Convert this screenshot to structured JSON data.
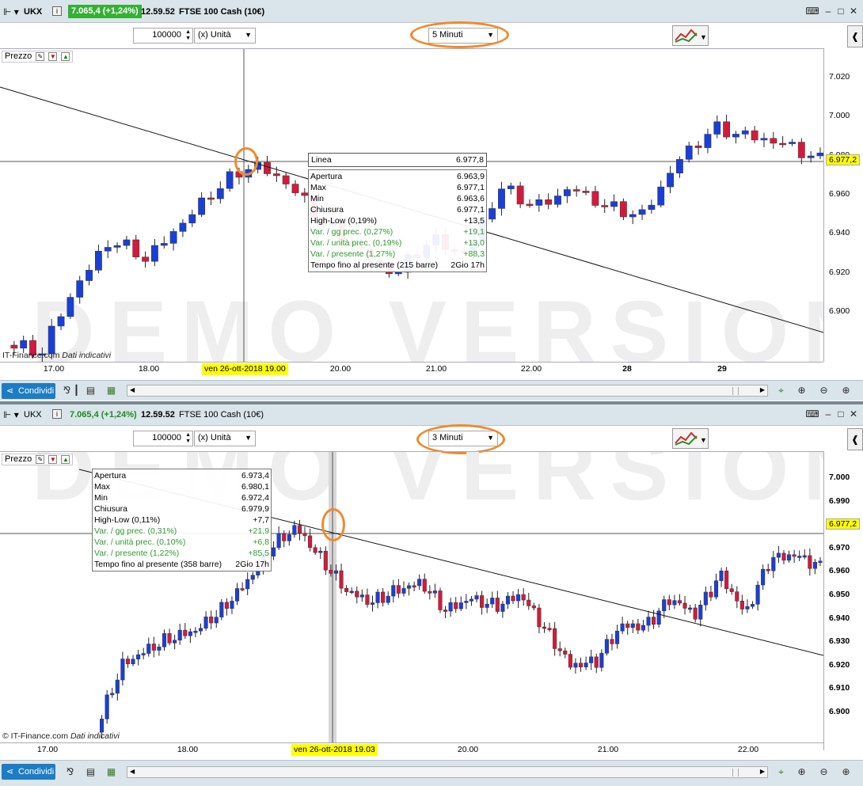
{
  "colors": {
    "up_candle": "#1a3fd8",
    "down_candle": "#d41a3c",
    "price_badge_bg": "#35b035",
    "highlight_yellow": "#ffff00",
    "annotation_orange": "#f08a2c",
    "share_button": "#1d7cc4"
  },
  "top": {
    "title": {
      "symbol": "UKX",
      "price_change": "7.065,4 (+1,24%)",
      "time": "12.59.52",
      "instrument": "FTSE 100 Cash (10€)"
    },
    "toolbar": {
      "quantity": "100000",
      "unit": "(x) Unità",
      "timeframe": "5 Minuti"
    },
    "prezzo_label": "Prezzo",
    "line_label": {
      "name": "Linea",
      "value": "6.977,8"
    },
    "tooltip": [
      {
        "label": "Apertura",
        "value": "6.963,9",
        "green": false
      },
      {
        "label": "Max",
        "value": "6.977,1",
        "green": false
      },
      {
        "label": "Min",
        "value": "6.963,6",
        "green": false
      },
      {
        "label": "Chiusura",
        "value": "6.977,1",
        "green": false
      },
      {
        "label": "High-Low (0,19%)",
        "value": "+13,5",
        "green": false
      },
      {
        "label": "Var. / gg prec. (0,27%)",
        "value": "+19,1",
        "green": true
      },
      {
        "label": "Var. / unità prec. (0,19%)",
        "value": "+13,0",
        "green": true
      },
      {
        "label": "Var. / presente (1,27%)",
        "value": "+88,3",
        "green": true
      },
      {
        "label": "Tempo fino al presente (215 barre)",
        "value": "2Gio 17h",
        "green": false
      }
    ],
    "y_ticks": [
      "7.020",
      "7.000",
      "6.980",
      "6.960",
      "6.940",
      "6.920",
      "6.900"
    ],
    "current_price": "6.977,2",
    "x_ticks": [
      "17.00",
      "18.00",
      "20.00",
      "21.00",
      "22.00",
      "28",
      "29"
    ],
    "x_highlight": "ven 26-ott-2018 19.00",
    "source": "IT-Finance.com",
    "source_note": "Dati indicativi",
    "share_label": "Condividi"
  },
  "bottom": {
    "title": {
      "symbol": "UKX",
      "price_change": "7.065,4 (+1,24%)",
      "time": "12.59.52",
      "instrument": "FTSE 100 Cash (10€)"
    },
    "toolbar": {
      "quantity": "100000",
      "unit": "(x) Unità",
      "timeframe": "3 Minuti"
    },
    "prezzo_label": "Prezzo",
    "tooltip": [
      {
        "label": "Apertura",
        "value": "6.973,4",
        "green": false
      },
      {
        "label": "Max",
        "value": "6.980,1",
        "green": false
      },
      {
        "label": "Min",
        "value": "6.972,4",
        "green": false
      },
      {
        "label": "Chiusura",
        "value": "6.979,9",
        "green": false
      },
      {
        "label": "High-Low (0,11%)",
        "value": "+7,7",
        "green": false
      },
      {
        "label": "Var. / gg prec. (0,31%)",
        "value": "+21,9",
        "green": true
      },
      {
        "label": "Var. / unità prec. (0,10%)",
        "value": "+6,8",
        "green": true
      },
      {
        "label": "Var. / presente (1,22%)",
        "value": "+85,5",
        "green": true
      },
      {
        "label": "Tempo fino al presente (358 barre)",
        "value": "2Gio 17h",
        "green": false
      }
    ],
    "y_ticks": [
      "7.000",
      "6.990",
      "6.980",
      "6.970",
      "6.960",
      "6.950",
      "6.940",
      "6.930",
      "6.920",
      "6.910",
      "6.900"
    ],
    "current_price": "6.977,2",
    "x_ticks": [
      "17.00",
      "18.00",
      "20.00",
      "21.00",
      "22.00"
    ],
    "x_highlight": "ven 26-ott-2018 19.03",
    "source": "© IT-Finance.com",
    "source_note": "Dati indicativi",
    "share_label": "Condividi"
  }
}
